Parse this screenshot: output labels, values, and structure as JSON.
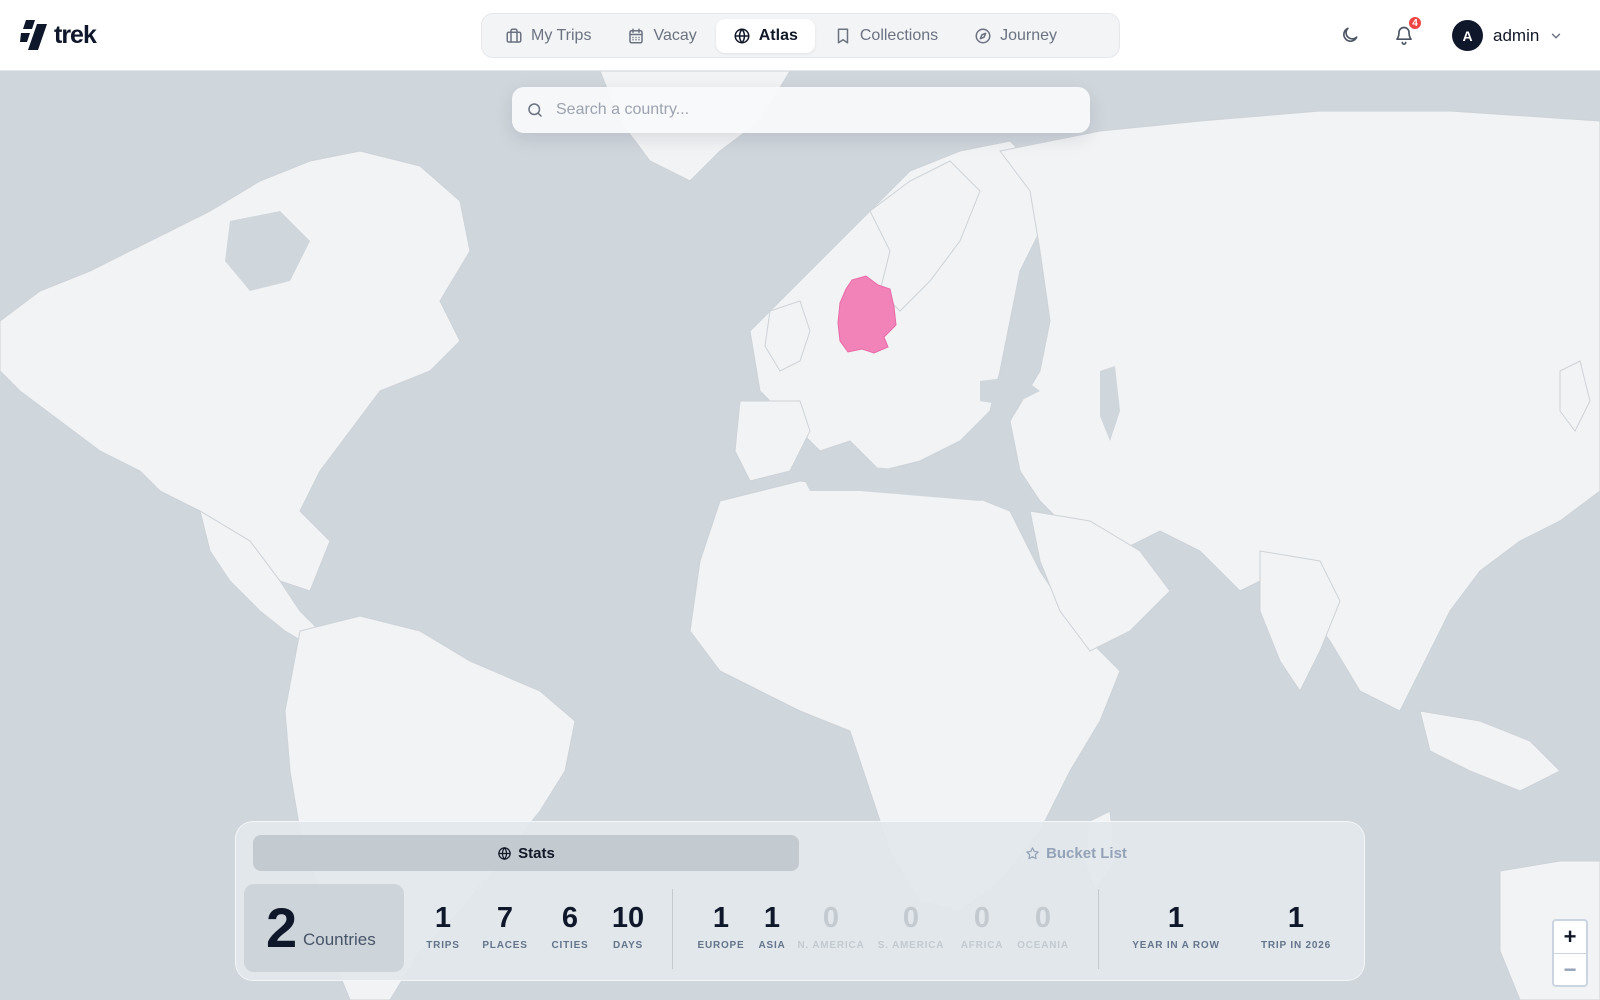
{
  "brand": {
    "name": "trek"
  },
  "nav": [
    {
      "label": "My Trips",
      "icon": "briefcase-icon",
      "active": false
    },
    {
      "label": "Vacay",
      "icon": "calendar-icon",
      "active": false
    },
    {
      "label": "Atlas",
      "icon": "globe-icon",
      "active": true
    },
    {
      "label": "Collections",
      "icon": "bookmark-icon",
      "active": false
    },
    {
      "label": "Journey",
      "icon": "compass-icon",
      "active": false
    }
  ],
  "header": {
    "theme_icon": "moon-icon",
    "notification_icon": "bell-icon",
    "notification_count": "4",
    "user_initial": "A",
    "user_name": "admin",
    "user_menu_icon": "chevron-down-icon"
  },
  "search": {
    "placeholder": "Search a country...",
    "value": "",
    "icon": "search-icon"
  },
  "map": {
    "visited_color": "#f283b9",
    "land_color": "#f1f3f5",
    "water_color": "#cfd6dc",
    "visited_countries_highlighted": [
      "Germany"
    ]
  },
  "panel": {
    "tabs": [
      {
        "label": "Stats",
        "icon": "globe-icon",
        "active": true
      },
      {
        "label": "Bucket List",
        "icon": "star-icon",
        "active": false
      }
    ],
    "countries": {
      "value": "2",
      "label": "Countries"
    },
    "totals": [
      {
        "value": "1",
        "label": "Trips"
      },
      {
        "value": "7",
        "label": "Places"
      },
      {
        "value": "6",
        "label": "Cities"
      },
      {
        "value": "10",
        "label": "Days"
      }
    ],
    "continents": [
      {
        "value": "1",
        "label": "Europe",
        "muted": false
      },
      {
        "value": "1",
        "label": "Asia",
        "muted": false
      },
      {
        "value": "0",
        "label": "N. America",
        "muted": true
      },
      {
        "value": "0",
        "label": "S. America",
        "muted": true
      },
      {
        "value": "0",
        "label": "Africa",
        "muted": true
      },
      {
        "value": "0",
        "label": "Oceania",
        "muted": true
      }
    ],
    "streaks": [
      {
        "value": "1",
        "label": "Year in a row"
      },
      {
        "value": "1",
        "label": "Trip in 2026"
      }
    ]
  },
  "zoom": {
    "in_label": "+",
    "out_label": "−"
  }
}
